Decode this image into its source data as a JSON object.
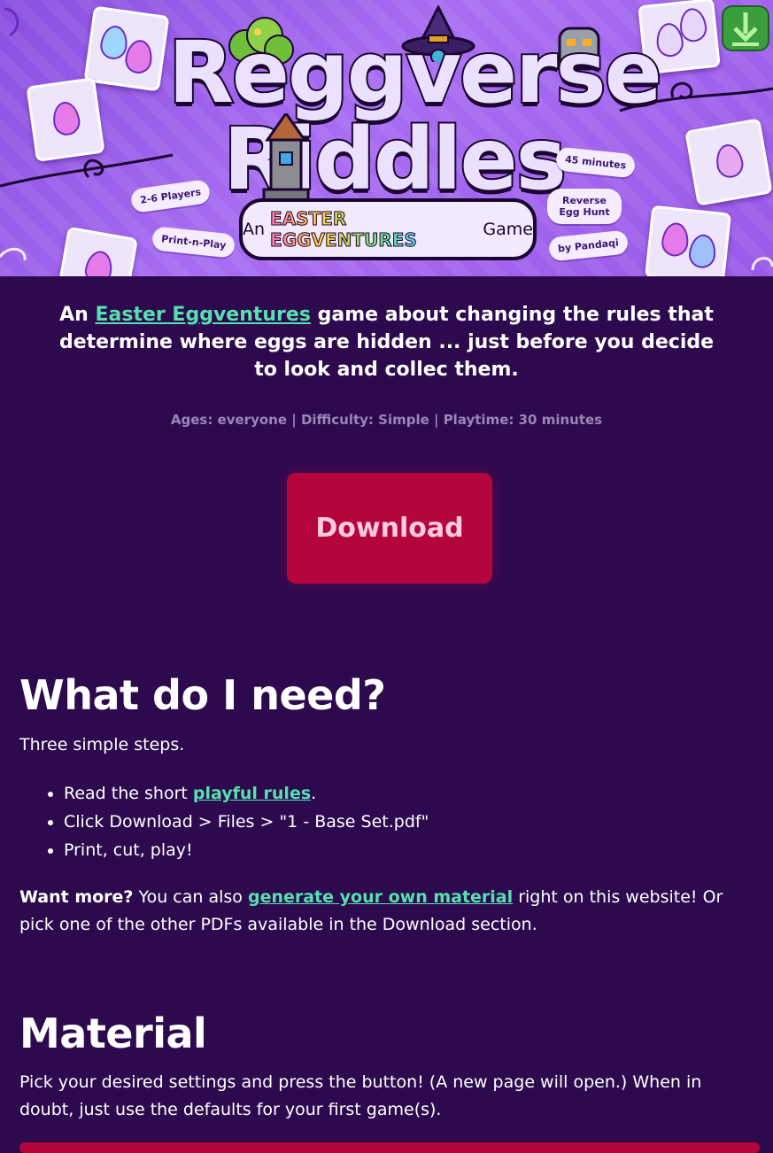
{
  "banner": {
    "title_line1": "Reggverse",
    "title_line2": "Riddles",
    "subtitle_prefix": "An",
    "subtitle_brand": "EASTER EGGVENTURES",
    "subtitle_suffix": "Game",
    "tags": {
      "players": "2-6 Players",
      "print": "Print-n-Play",
      "minutes": "45 minutes",
      "reverse": "Reverse Egg Hunt",
      "by": "by Pandaqi"
    },
    "colors": {
      "banner": "#9a5ae8",
      "card": "#efe5fb",
      "outline": "#1a0630"
    }
  },
  "intro": {
    "prefix": "An",
    "link_text": "Easter Eggventures",
    "suffix": "game about changing the rules that determine where eggs are hidden ... just before you decide to look and collec them."
  },
  "meta": "Ages: everyone | Difficulty: Simple | Playtime: 30 minutes",
  "download_button": "Download",
  "need": {
    "heading": "What do I need?",
    "lead": "Three simple steps.",
    "steps": [
      {
        "prefix": "Read the short",
        "link": "playful rules",
        "suffix": "."
      },
      {
        "text": "Click Download > Files > \"1 - Base Set.pdf\""
      },
      {
        "text": "Print, cut, play!"
      }
    ],
    "more_label": "Want more?",
    "more_prefix": "You can also",
    "more_link": "generate your own material",
    "more_suffix": "right on this website! Or pick one of the other PDFs available in the Download section."
  },
  "material": {
    "heading": "Material",
    "text": "Pick your desired settings and press the button! (A new page will open.) When in doubt, just use the defaults for your first game(s)."
  },
  "theme": {
    "background": "#2d0a4e",
    "link": "#56e0b0",
    "button": "#b4063c",
    "button_text": "#ffcbe0",
    "muted": "#9b86b8"
  },
  "icons": [
    "download-arrow-icon",
    "egg-icon",
    "tower-icon",
    "witch-hat-icon",
    "robot-head-icon",
    "bush-icon"
  ]
}
